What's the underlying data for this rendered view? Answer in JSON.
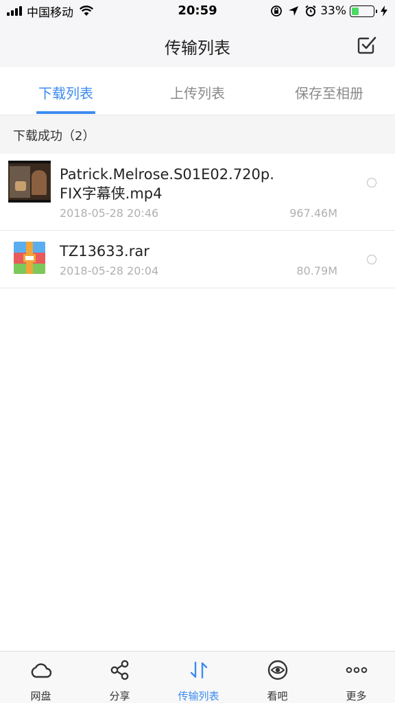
{
  "status_bar": {
    "carrier": "中国移动",
    "time": "20:59",
    "battery_percent": "33%",
    "battery_level": 0.33,
    "icons": [
      "signal-icon",
      "wifi-icon",
      "orientation-lock-icon",
      "location-icon",
      "alarm-icon",
      "battery-icon",
      "charging-icon"
    ]
  },
  "nav": {
    "title": "传输列表",
    "edit_icon": "checkbox-edit-icon"
  },
  "tabs": [
    {
      "label": "下载列表",
      "active": true
    },
    {
      "label": "上传列表",
      "active": false
    },
    {
      "label": "保存至相册",
      "active": false
    }
  ],
  "section": {
    "title": "下载成功（2）"
  },
  "files": [
    {
      "name_line1": "Patrick.Melrose.S01E02.720p.",
      "name_line2": "FIX字幕侠.mp4",
      "date": "2018-05-28 20:46",
      "size": "967.46M",
      "icon": "video-thumbnail"
    },
    {
      "name": "TZ13633.rar",
      "date": "2018-05-28 20:04",
      "size": "80.79M",
      "icon": "rar-archive-icon"
    }
  ],
  "tab_bar": {
    "accent_color": "#3e8bf0",
    "items": [
      {
        "label": "网盘",
        "icon": "cloud-icon",
        "active": false
      },
      {
        "label": "分享",
        "icon": "share-icon",
        "active": false
      },
      {
        "label": "传输列表",
        "icon": "transfer-icon",
        "active": true
      },
      {
        "label": "看吧",
        "icon": "eye-icon",
        "active": false
      },
      {
        "label": "更多",
        "icon": "more-icon",
        "active": false
      }
    ]
  }
}
